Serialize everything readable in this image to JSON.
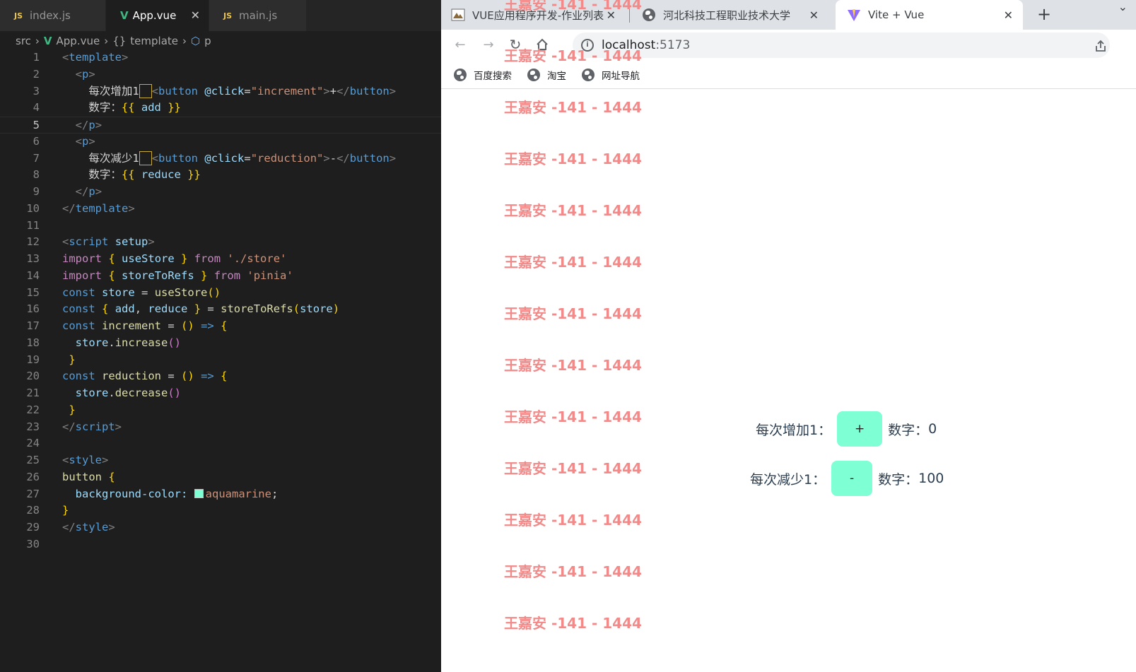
{
  "editor": {
    "tabs": [
      {
        "icon": "JS",
        "label": "index.js"
      },
      {
        "icon": "V",
        "label": "App.vue",
        "close": "✕"
      },
      {
        "icon": "JS",
        "label": "main.js"
      }
    ],
    "breadcrumb": {
      "src": "src",
      "file": "App.vue",
      "node1": "template",
      "node1_icon": "{}",
      "node2": "p"
    },
    "line_numbers": [
      "1",
      "2",
      "3",
      "4",
      "5",
      "6",
      "7",
      "8",
      "9",
      "10",
      "11",
      "12",
      "13",
      "14",
      "15",
      "16",
      "17",
      "18",
      "19",
      "20",
      "21",
      "22",
      "23",
      "24",
      "25",
      "26",
      "27",
      "28",
      "29",
      "30"
    ],
    "code": {
      "template_tag": "template",
      "p_tag": "p",
      "button_tag": "button",
      "click_attr": "@click",
      "eq": "=",
      "q": "\"",
      "inc_handler": "increment",
      "red_handler": "reduction",
      "inc_label_text": "每次增加1",
      "red_label_text": "每次减少1",
      "plus": "+",
      "minus": "-",
      "num_label": "数字：",
      "lb": "{{",
      "rb": "}}",
      "add_var": "add",
      "reduce_var": "reduce",
      "script_tag": "script",
      "setup_attr": "setup",
      "import_kw": "import",
      "from_kw": "from",
      "const_kw": "const",
      "useStore": "useStore",
      "storeToRefs": "storeToRefs",
      "store_path": "'./store'",
      "pinia_path": "'pinia'",
      "store_var": "store",
      "increase_call": "increase",
      "decrease_call": "decrease",
      "arrow": "=>",
      "style_tag": "style",
      "button_sel": "button",
      "bg_prop": "background-color:",
      "bg_val": "aquamarine"
    }
  },
  "browser": {
    "tabs": [
      {
        "label": "VUE应用程序开发-作业列表",
        "close": "✕"
      },
      {
        "label": "河北科技工程职业技术大学",
        "close": "✕"
      },
      {
        "label": "Vite + Vue",
        "close": "✕"
      }
    ],
    "new_tab": "+",
    "tab_menu": "⌄",
    "url_host": "localhost",
    "url_port": ":5173",
    "bookmarks": [
      "百度搜索",
      "淘宝",
      "网址导航"
    ],
    "watermark": "王嘉安 -141 - 1444",
    "app": {
      "inc_label": "每次增加1：",
      "inc_button": "+",
      "inc_value_label": "数字：",
      "inc_value": "0",
      "red_label": "每次减少1：",
      "red_button": "-",
      "red_value_label": "数字：",
      "red_value": "100"
    },
    "button_color": "#7fffd4",
    "watermark_color": "#f28a8a"
  }
}
